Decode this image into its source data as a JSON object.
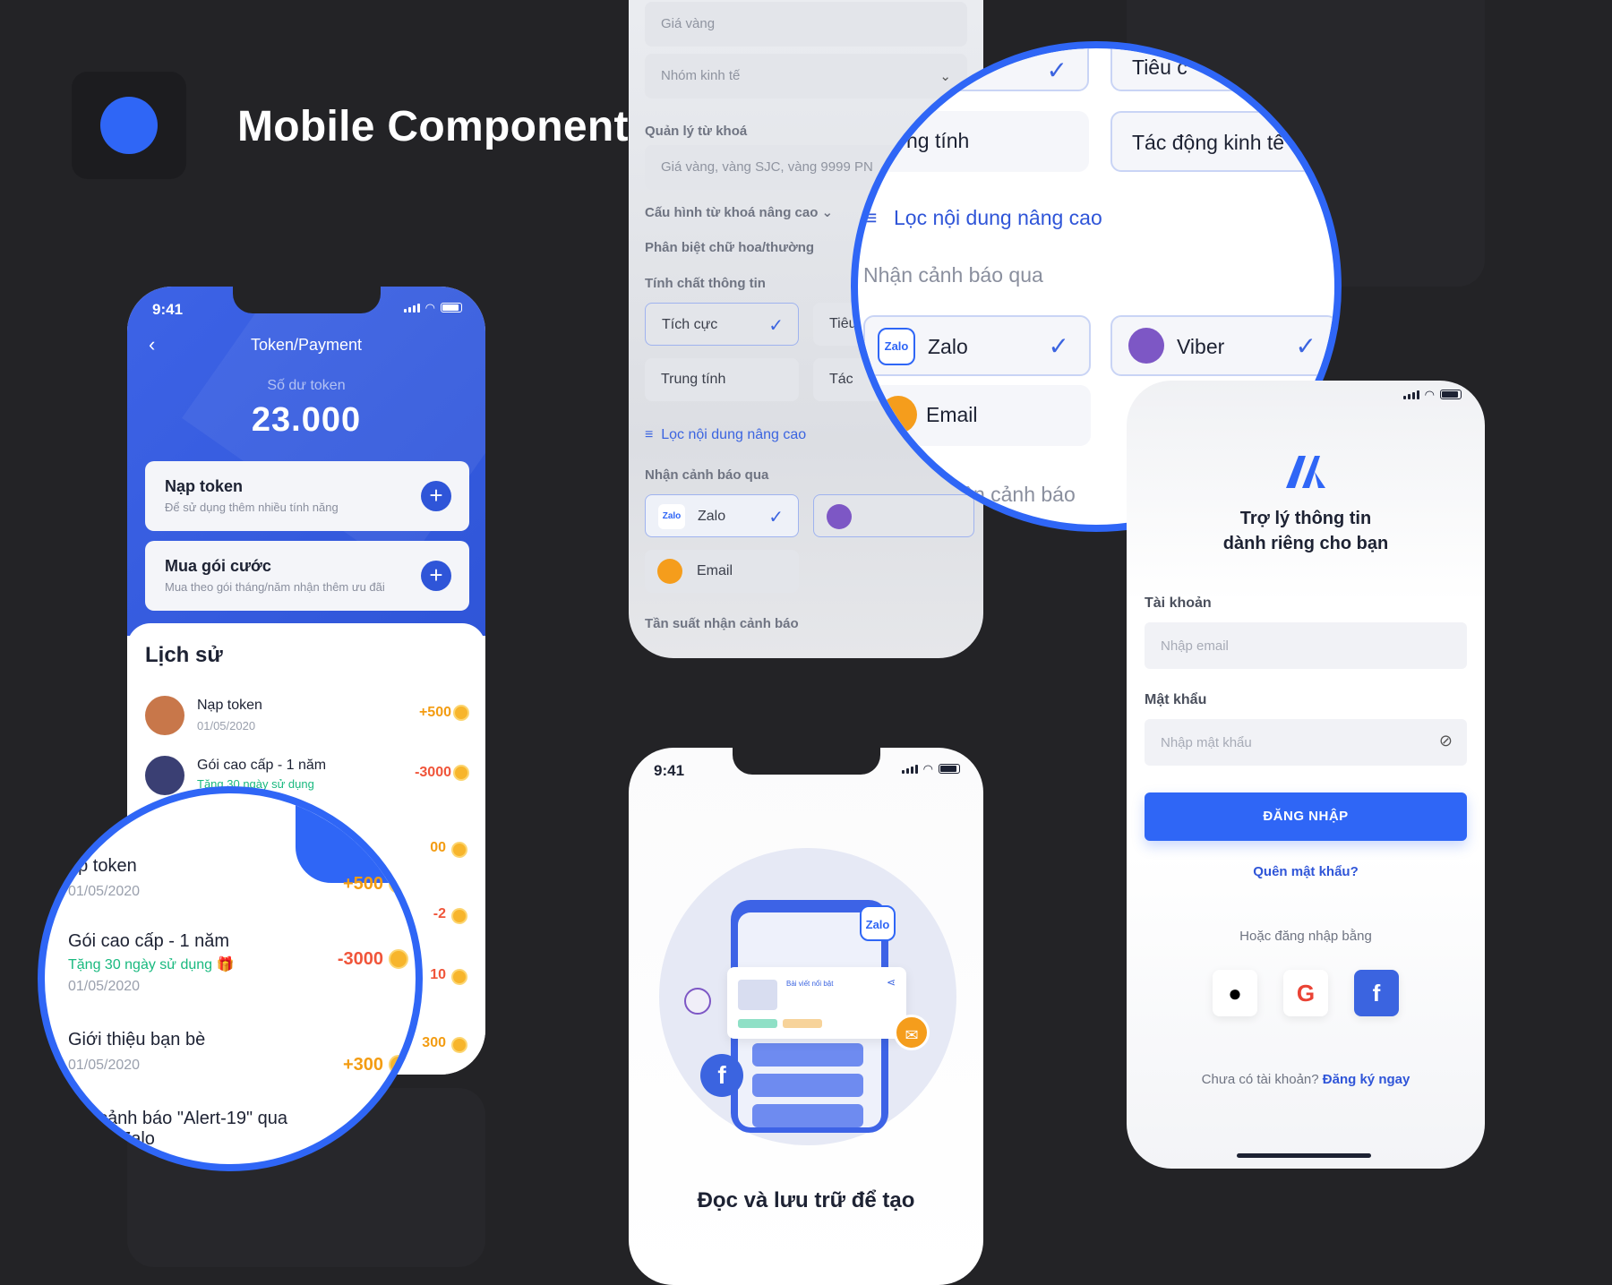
{
  "header": {
    "title": "Mobile Components"
  },
  "colors": {
    "brand": "#2f66f6",
    "background": "#232326",
    "positive": "#f39c12",
    "negative": "#f0553a",
    "green": "#19b97f"
  },
  "payment": {
    "time": "9:41",
    "title": "Token/Payment",
    "balance_label": "Số dư token",
    "balance": "23.000",
    "card1_title": "Nạp token",
    "card1_sub": "Để sử dụng thêm nhiều tính năng",
    "card2_title": "Mua gói cước",
    "card2_sub": "Mua theo gói tháng/năm nhận thêm ưu đãi",
    "history_title": "Lịch sử",
    "history": [
      {
        "name": "Nạp token",
        "date": "01/05/2020",
        "amount": "+500"
      },
      {
        "name": "Gói cao cấp - 1 năm",
        "sub": "Tặng 30 ngày sử dụng",
        "amount": "-3000"
      }
    ],
    "side_amounts": [
      "00",
      "-2",
      "10",
      "300"
    ]
  },
  "magnifier1": {
    "rows": [
      {
        "name": "ạp token",
        "date": "01/05/2020",
        "amount": "+500"
      },
      {
        "name": "Gói cao cấp - 1 năm",
        "sub": "Tặng 30 ngày sử dụng 🎁",
        "date": "01/05/2020",
        "amount": "-3000"
      },
      {
        "name": "Giới thiệu bạn bè",
        "date": "01/05/2020",
        "amount": "+300"
      },
      {
        "name": "cảnh báo \"Alert-19\" qua",
        "sub2": "Zalo"
      }
    ]
  },
  "settings": {
    "gold_field": "Giá vàng",
    "group_select": "Nhóm kinh tế",
    "keywords_label": "Quản lý từ khoá",
    "keywords_value": "Giá vàng, vàng SJC, vàng 9999 PN",
    "advanced_keywords": "Cấu hình từ khoá nâng cao",
    "case_sensitive": "Phân biệt chữ hoa/thường",
    "nature_label": "Tính chất thông tin",
    "chips": [
      "Tích cực",
      "Tiêu",
      "Trung tính",
      "Tác"
    ],
    "advanced_filter": "Lọc nội dung nâng cao",
    "notify_label": "Nhận cảnh báo qua",
    "zalo": "Zalo",
    "email": "Email",
    "frequency": "Tần suất nhận cảnh báo"
  },
  "magnifier2": {
    "top_chip": "Tiêu c",
    "neutral": "ng tính",
    "econ": "Tác động kinh tế",
    "advanced_filter": "Lọc nội dung nâng cao",
    "notify_label": "Nhận cảnh báo qua",
    "zalo": "Zalo",
    "viber": "Viber",
    "email": "Email",
    "footer": "ất nhận cảnh báo"
  },
  "onboarding": {
    "time": "9:41",
    "heading": "Đọc và lưu trữ để tạo",
    "card_text": "Bài viết nổi bật",
    "zalo": "Zalo"
  },
  "login": {
    "tagline1": "Trợ lý thông tin",
    "tagline2": "dành riêng cho bạn",
    "account_label": "Tài khoản",
    "email_placeholder": "Nhập email",
    "password_label": "Mật khẩu",
    "password_placeholder": "Nhập mật khẩu",
    "login_button": "ĐĂNG NHẬP",
    "forgot": "Quên mật khẩu?",
    "or_login": "Hoặc đăng nhập bằng",
    "no_account": "Chưa có tài khoản?",
    "signup": "Đăng ký ngay"
  }
}
